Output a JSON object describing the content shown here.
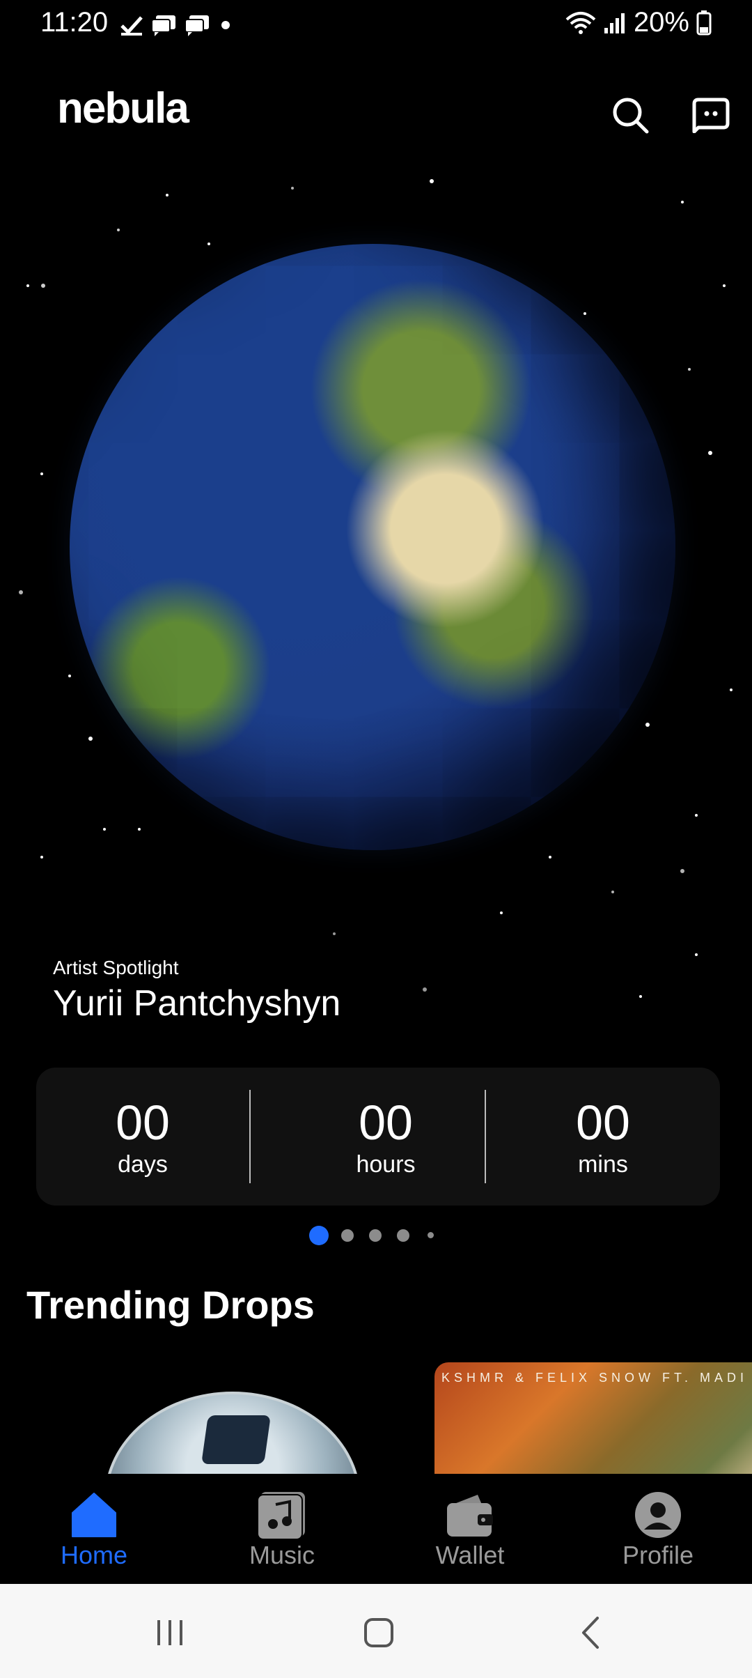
{
  "status_bar": {
    "time": "11:20",
    "battery": "20%",
    "icons": [
      "check-icon",
      "message-icon",
      "message-icon",
      "dot-icon",
      "wifi-icon",
      "signal-icon",
      "battery-icon"
    ]
  },
  "header": {
    "logo": "nebula",
    "actions": [
      "search-icon",
      "chat-icon"
    ]
  },
  "spotlight": {
    "label": "Artist Spotlight",
    "name": "Yurii Pantchyshyn"
  },
  "countdown": {
    "days": {
      "value": "00",
      "label": "days"
    },
    "hours": {
      "value": "00",
      "label": "hours"
    },
    "mins": {
      "value": "00",
      "label": "mins"
    }
  },
  "carousel": {
    "page_count": 5,
    "active_index": 0
  },
  "trending": {
    "title": "Trending Drops",
    "cards": [
      {
        "image": "geodesic-dome-art"
      },
      {
        "caption": "KSHMR & FELIX SNOW FT. MADI TOUC",
        "image": "autumn-tree-art"
      }
    ]
  },
  "bottom_nav": [
    {
      "label": "Home",
      "icon": "home-icon",
      "active": true
    },
    {
      "label": "Music",
      "icon": "music-icon",
      "active": false
    },
    {
      "label": "Wallet",
      "icon": "wallet-icon",
      "active": false
    },
    {
      "label": "Profile",
      "icon": "profile-icon",
      "active": false
    }
  ],
  "colors": {
    "accent": "#1f6cff",
    "inactive": "#9a9a9a",
    "background": "#000000",
    "panel": "#111111"
  }
}
